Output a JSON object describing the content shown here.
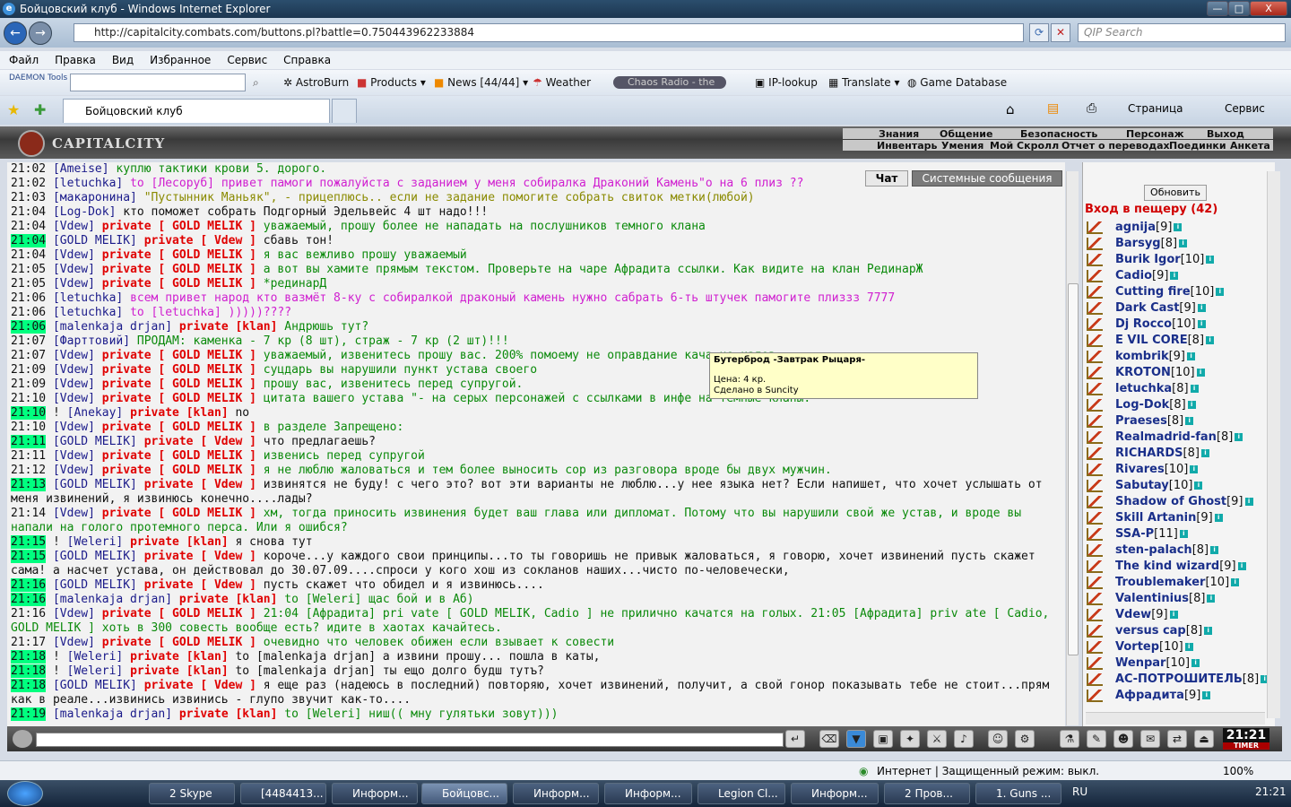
{
  "window": {
    "title": "Бойцовский клуб - Windows Internet Explorer",
    "min": "—",
    "max": "□",
    "close": "X"
  },
  "address": {
    "url": "http://capitalcity.combats.com/buttons.pl?battle=0.750443962233884",
    "search_placeholder": "QIP Search"
  },
  "menu": [
    "Файл",
    "Правка",
    "Вид",
    "Избранное",
    "Сервис",
    "Справка"
  ],
  "toolbar": {
    "daemon": "DAEMON Tools",
    "astroburn": "AstroBurn",
    "products": "Products",
    "news": "News [44/44]",
    "weather": "Weather",
    "radio": "Chaos Radio - the",
    "iplookup": "IP-lookup",
    "translate": "Translate",
    "gamedb": "Game Database"
  },
  "tabs": {
    "active": "Бойцовский клуб",
    "page": "Страница",
    "service": "Сервис"
  },
  "game": {
    "logo": "CAPITALCITY",
    "nav1": [
      "Знания",
      "Общение",
      "Безопасность",
      "Персонаж",
      "Выход"
    ],
    "nav2": [
      "Инвентарь",
      "Умения",
      "Мой Скролл",
      "Отчет о переводах",
      "Поединки",
      "Анкета"
    ],
    "chat_tabs": [
      "Чат",
      "Системные сообщения"
    ],
    "refresh": "Обновить",
    "cave_title": "Вход в пещеру (42)",
    "clock": "21:21",
    "timer": "TIMER"
  },
  "chat": [
    {
      "t": "21:02",
      "hl": false,
      "parts": [
        {
          "c": "nv",
          "x": "[Ameise]"
        },
        {
          "c": "gr",
          "x": " куплю тактики крови 5. дорого."
        }
      ]
    },
    {
      "t": "21:02",
      "hl": false,
      "parts": [
        {
          "c": "nv",
          "x": "[letuchka]"
        },
        {
          "c": "mg",
          "x": " to [Лесоруб] привет памоги пожалуйста с заданием у меня собиралка Драконий Камень\"о на 6 плиз ??"
        }
      ]
    },
    {
      "t": "21:03",
      "hl": false,
      "parts": [
        {
          "c": "nv",
          "x": "[макаронина]"
        },
        {
          "c": "ol",
          "x": " \"Пустынник Маньяк\", - прицеплюсь.. если не задание помогите собрать свиток метки(любой)"
        }
      ]
    },
    {
      "t": "21:04",
      "hl": false,
      "parts": [
        {
          "c": "nv",
          "x": "[Log-Dok]"
        },
        {
          "c": "t",
          "x": " кто поможет собрать Подгорный Эдельвейс 4 шт надо!!!"
        }
      ]
    },
    {
      "t": "21:04",
      "hl": false,
      "parts": [
        {
          "c": "nv",
          "x": "[Vdew]"
        },
        {
          "c": "pv",
          "x": " private [ GOLD MELIK ]"
        },
        {
          "c": "gr",
          "x": " уважаемый, прошу более не нападать на послушников темного клана"
        }
      ]
    },
    {
      "t": "21:04",
      "hl": true,
      "parts": [
        {
          "c": "nv",
          "x": "[GOLD MELIK]"
        },
        {
          "c": "pv",
          "x": " private [ Vdew ]"
        },
        {
          "c": "t",
          "x": " сбавь тон!"
        }
      ]
    },
    {
      "t": "21:04",
      "hl": false,
      "parts": [
        {
          "c": "nv",
          "x": "[Vdew]"
        },
        {
          "c": "pv",
          "x": " private [ GOLD MELIK ]"
        },
        {
          "c": "gr",
          "x": " я вас вежливо прошу уважаемый"
        }
      ]
    },
    {
      "t": "21:05",
      "hl": false,
      "parts": [
        {
          "c": "nv",
          "x": "[Vdew]"
        },
        {
          "c": "pv",
          "x": " private [ GOLD MELIK ]"
        },
        {
          "c": "gr",
          "x": " а вот вы хамите прямым текстом. Проверьте на чаре Афрадита ссылки. Как видите на клан РединарЖ"
        }
      ]
    },
    {
      "t": "21:05",
      "hl": false,
      "parts": [
        {
          "c": "nv",
          "x": "[Vdew]"
        },
        {
          "c": "pv",
          "x": " private [ GOLD MELIK ]"
        },
        {
          "c": "gr",
          "x": " *рединарД"
        }
      ]
    },
    {
      "t": "21:06",
      "hl": false,
      "parts": [
        {
          "c": "nv",
          "x": "[letuchka]"
        },
        {
          "c": "mg",
          "x": " всем привет народ кто вазмёт 8-ку с собиралкой драконый камень нужно сабрать 6-ть штучек памогите плиззз 7777"
        }
      ]
    },
    {
      "t": "21:06",
      "hl": false,
      "parts": [
        {
          "c": "nv",
          "x": "[letuchka]"
        },
        {
          "c": "mg",
          "x": " to [letuchka] )))))????"
        }
      ]
    },
    {
      "t": "21:06",
      "hl": true,
      "parts": [
        {
          "c": "nv",
          "x": "[malenkaja drjan]"
        },
        {
          "c": "pv",
          "x": " private [klan]"
        },
        {
          "c": "gr",
          "x": " Андрюшь тут?"
        }
      ]
    },
    {
      "t": "21:07",
      "hl": false,
      "parts": [
        {
          "c": "nv",
          "x": "[Фарттовий]"
        },
        {
          "c": "gr",
          "x": " ПРОДАМ: каменка - 7 кр (8 шт), страж - 7 кр (2 шт)!!!"
        }
      ]
    },
    {
      "t": "21:07",
      "hl": false,
      "parts": [
        {
          "c": "nv",
          "x": "[Vdew]"
        },
        {
          "c": "pv",
          "x": " private [ GOLD MELIK ]"
        },
        {
          "c": "gr",
          "x": " уважаемый, извенитесь прошу вас. 200% помоему не оправдание кача не                                    калов."
        }
      ]
    },
    {
      "t": "21:09",
      "hl": false,
      "parts": [
        {
          "c": "nv",
          "x": "[Vdew]"
        },
        {
          "c": "pv",
          "x": " private [ GOLD MELIK ]"
        },
        {
          "c": "gr",
          "x": " суцдарь вы нарушили пункт устава своего"
        }
      ]
    },
    {
      "t": "21:09",
      "hl": false,
      "parts": [
        {
          "c": "nv",
          "x": "[Vdew]"
        },
        {
          "c": "pv",
          "x": " private [ GOLD MELIK ]"
        },
        {
          "c": "gr",
          "x": " прошу вас, извенитесь перед супругой."
        }
      ]
    },
    {
      "t": "21:10",
      "hl": false,
      "parts": [
        {
          "c": "nv",
          "x": "[Vdew]"
        },
        {
          "c": "pv",
          "x": " private [ GOLD MELIK ]"
        },
        {
          "c": "gr",
          "x": " цитата вашего устава \"- на серых персонажей с ссылками в инфе на темные кланы. \""
        }
      ]
    },
    {
      "t": "21:10",
      "hl": true,
      "parts": [
        {
          "c": "t",
          "x": "! "
        },
        {
          "c": "nv",
          "x": "[Anekay]"
        },
        {
          "c": "pv",
          "x": " private [klan]"
        },
        {
          "c": "t",
          "x": " no"
        }
      ]
    },
    {
      "t": "21:10",
      "hl": false,
      "parts": [
        {
          "c": "nv",
          "x": "[Vdew]"
        },
        {
          "c": "pv",
          "x": " private [ GOLD MELIK ]"
        },
        {
          "c": "gr",
          "x": " в разделе Запрещено:"
        }
      ]
    },
    {
      "t": "21:11",
      "hl": true,
      "parts": [
        {
          "c": "nv",
          "x": "[GOLD MELIK]"
        },
        {
          "c": "pv",
          "x": " private [ Vdew ]"
        },
        {
          "c": "t",
          "x": " что предлагаешь?"
        }
      ]
    },
    {
      "t": "21:11",
      "hl": false,
      "parts": [
        {
          "c": "nv",
          "x": "[Vdew]"
        },
        {
          "c": "pv",
          "x": " private [ GOLD MELIK ]"
        },
        {
          "c": "gr",
          "x": " извенись перед супругой"
        }
      ]
    },
    {
      "t": "21:12",
      "hl": false,
      "parts": [
        {
          "c": "nv",
          "x": "[Vdew]"
        },
        {
          "c": "pv",
          "x": " private [ GOLD MELIK ]"
        },
        {
          "c": "gr",
          "x": " я не люблю жаловаться и тем более выносить сор из разговора вроде бы двух мужчин."
        }
      ]
    },
    {
      "t": "21:13",
      "hl": true,
      "parts": [
        {
          "c": "nv",
          "x": "[GOLD MELIK]"
        },
        {
          "c": "pv",
          "x": " private [ Vdew ]"
        },
        {
          "c": "t",
          "x": " извинятся не буду! с чего это? вот эти варианты не люблю...у нее языка нет? Если напишет, что хочет услышать от меня извинений, я извинюсь конечно....лады?"
        }
      ]
    },
    {
      "t": "21:14",
      "hl": false,
      "parts": [
        {
          "c": "nv",
          "x": "[Vdew]"
        },
        {
          "c": "pv",
          "x": " private [ GOLD MELIK ]"
        },
        {
          "c": "gr",
          "x": " хм, тогда приносить извинения будет ваш глава или дипломат. Потому что вы нарушили свой же устав, и вроде вы напали на голого протемного перса. Или я ошибся?"
        }
      ]
    },
    {
      "t": "21:15",
      "hl": true,
      "parts": [
        {
          "c": "t",
          "x": "! "
        },
        {
          "c": "nv",
          "x": "[Weleri]"
        },
        {
          "c": "pv",
          "x": " private [klan]"
        },
        {
          "c": "t",
          "x": " я снова тут"
        }
      ]
    },
    {
      "t": "21:15",
      "hl": true,
      "parts": [
        {
          "c": "nv",
          "x": "[GOLD MELIK]"
        },
        {
          "c": "pv",
          "x": " private [ Vdew ]"
        },
        {
          "c": "t",
          "x": " короче...у каждого свои принципы...то ты говоришь не привык жаловаться, я говорю, хочет извинений пусть скажет сама! а насчет устава, он действовал до 30.07.09....спроси у кого хош из сокланов наших...чисто по-человечески,"
        }
      ]
    },
    {
      "t": "21:16",
      "hl": true,
      "parts": [
        {
          "c": "nv",
          "x": "[GOLD MELIK]"
        },
        {
          "c": "pv",
          "x": " private [ Vdew ]"
        },
        {
          "c": "t",
          "x": " пусть скажет что обидел и я извинюсь...."
        }
      ]
    },
    {
      "t": "21:16",
      "hl": true,
      "parts": [
        {
          "c": "nv",
          "x": "[malenkaja drjan]"
        },
        {
          "c": "pv",
          "x": " private [klan]"
        },
        {
          "c": "gr",
          "x": " to [Weleri] щас бой и в Аб)"
        }
      ]
    },
    {
      "t": "21:16",
      "hl": false,
      "parts": [
        {
          "c": "nv",
          "x": "[Vdew]"
        },
        {
          "c": "pv",
          "x": " private [ GOLD MELIK ]"
        },
        {
          "c": "gr",
          "x": " 21:04 [Афрадита] pri vate [ GOLD MELIK, Cadio ] не прилично качатся на голых. 21:05 [Афрадита] priv ate [ Cadio, GOLD MELIK ] хоть в 300 совесть вообще есть? идите в хаотах качайтесь."
        }
      ]
    },
    {
      "t": "21:17",
      "hl": false,
      "parts": [
        {
          "c": "nv",
          "x": "[Vdew]"
        },
        {
          "c": "pv",
          "x": " private [ GOLD MELIK ]"
        },
        {
          "c": "gr",
          "x": " очевидно что человек обижен если взывает к совести"
        }
      ]
    },
    {
      "t": "21:18",
      "hl": true,
      "parts": [
        {
          "c": "t",
          "x": "! "
        },
        {
          "c": "nv",
          "x": "[Weleri]"
        },
        {
          "c": "pv",
          "x": " private [klan]"
        },
        {
          "c": "t",
          "x": " to [malenkaja drjan] а извини прошу... пошла в каты,"
        }
      ]
    },
    {
      "t": "21:18",
      "hl": true,
      "parts": [
        {
          "c": "t",
          "x": "! "
        },
        {
          "c": "nv",
          "x": "[Weleri]"
        },
        {
          "c": "pv",
          "x": " private [klan]"
        },
        {
          "c": "t",
          "x": " to [malenkaja drjan] ты ещо долго будш тутъ?"
        }
      ]
    },
    {
      "t": "21:18",
      "hl": true,
      "parts": [
        {
          "c": "nv",
          "x": "[GOLD MELIK]"
        },
        {
          "c": "pv",
          "x": " private [ Vdew ]"
        },
        {
          "c": "t",
          "x": " я еще раз (надеюсь в последний) повторяю, хочет извинений, получит, а свой гонор показывать тебе не стоит...прям как в реале...извинись извинись - глупо звучит как-то...."
        }
      ]
    },
    {
      "t": "21:19",
      "hl": true,
      "parts": [
        {
          "c": "nv",
          "x": "[malenkaja drjan]"
        },
        {
          "c": "pv",
          "x": " private [klan]"
        },
        {
          "c": "gr",
          "x": " to [Weleri] ниш(( мну гулятьки зовут)))"
        }
      ]
    }
  ],
  "tooltip": {
    "title": "Бутерброд -Завтрак Рыцаря-",
    "price": "Цена: 4 кр.",
    "made": "Сделано в Suncity"
  },
  "users": [
    {
      "n": "agnija",
      "l": "[9]"
    },
    {
      "n": "Barsyg",
      "l": "[8]"
    },
    {
      "n": "Burik Igor",
      "l": "[10]"
    },
    {
      "n": "Cadio",
      "l": "[9]"
    },
    {
      "n": "Cutting fire",
      "l": "[10]"
    },
    {
      "n": "Dark Cast",
      "l": "[9]"
    },
    {
      "n": "Dj Rocco",
      "l": "[10]"
    },
    {
      "n": "E VIL CORE",
      "l": "[8]"
    },
    {
      "n": "kombrik",
      "l": "[9]"
    },
    {
      "n": "KROTON",
      "l": "[10]"
    },
    {
      "n": "letuchka",
      "l": "[8]"
    },
    {
      "n": "Log-Dok",
      "l": "[8]"
    },
    {
      "n": "Praeses",
      "l": "[8]"
    },
    {
      "n": "Realmadrid-fan",
      "l": "[8]"
    },
    {
      "n": "RICHARDS",
      "l": "[8]"
    },
    {
      "n": "Rivares",
      "l": "[10]"
    },
    {
      "n": "Sabutay",
      "l": "[10]"
    },
    {
      "n": "Shadow of Ghost",
      "l": "[9]"
    },
    {
      "n": "Skill Artanin",
      "l": "[9]"
    },
    {
      "n": "SSA-P",
      "l": "[11]"
    },
    {
      "n": "sten-palach",
      "l": "[8]"
    },
    {
      "n": "The kind wizard",
      "l": "[9]"
    },
    {
      "n": "Troublemaker",
      "l": "[10]"
    },
    {
      "n": "Valentinius",
      "l": "[8]"
    },
    {
      "n": "Vdew",
      "l": "[9]"
    },
    {
      "n": "versus cap",
      "l": "[8]"
    },
    {
      "n": "Vortep",
      "l": "[10]"
    },
    {
      "n": "Wenpar",
      "l": "[10]"
    },
    {
      "n": "АС-ПОТРОШИТЕЛЬ",
      "l": "[8]"
    },
    {
      "n": "Афрадита",
      "l": "[9]"
    }
  ],
  "status": {
    "zone": "Интернет | Защищенный режим: выкл.",
    "zoom": "100%"
  },
  "taskbar": {
    "items": [
      "2 Skype",
      "[4484413...",
      "Информ...",
      "Бойцовс...",
      "Информ...",
      "Информ...",
      "Legion Cl...",
      "Информ...",
      "2 Пров...",
      "1. Guns ..."
    ],
    "lang": "RU",
    "time": "21:21"
  }
}
